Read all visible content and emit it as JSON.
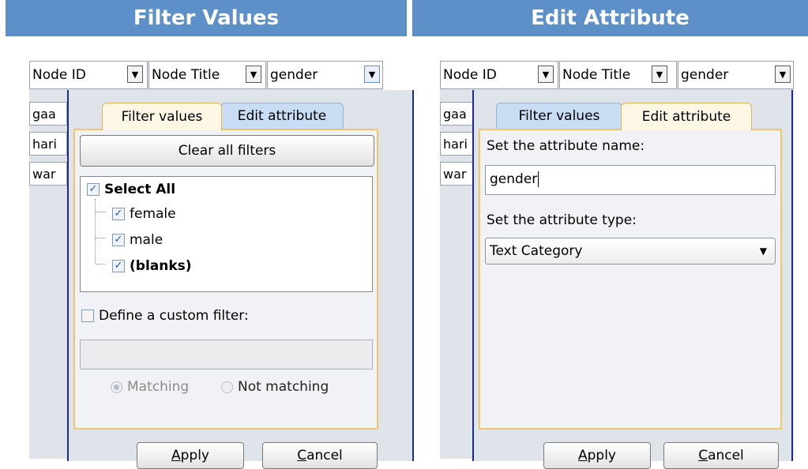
{
  "left_banner": "Filter Values",
  "right_banner": "Edit Attribute",
  "columns": [
    "Node ID",
    "Node Title",
    "gender"
  ],
  "rows": [
    "gaa",
    "hari",
    "war"
  ],
  "tabs": {
    "filter_values": "Filter values",
    "edit_attribute": "Edit attribute"
  },
  "filter": {
    "clear_all": "Clear all filters",
    "select_all": "Select All",
    "items": [
      "female",
      "male",
      "(blanks)"
    ],
    "custom_filter_label": "Define a custom filter:",
    "custom_filter_value": "",
    "matching": "Matching",
    "not_matching": "Not matching"
  },
  "edit": {
    "name_label": "Set the attribute name:",
    "name_value": "gender",
    "type_label": "Set the attribute type:",
    "type_value": "Text Category"
  },
  "buttons": {
    "apply_first": "A",
    "apply_rest": "pply",
    "cancel_first": "C",
    "cancel_rest": "ancel"
  }
}
